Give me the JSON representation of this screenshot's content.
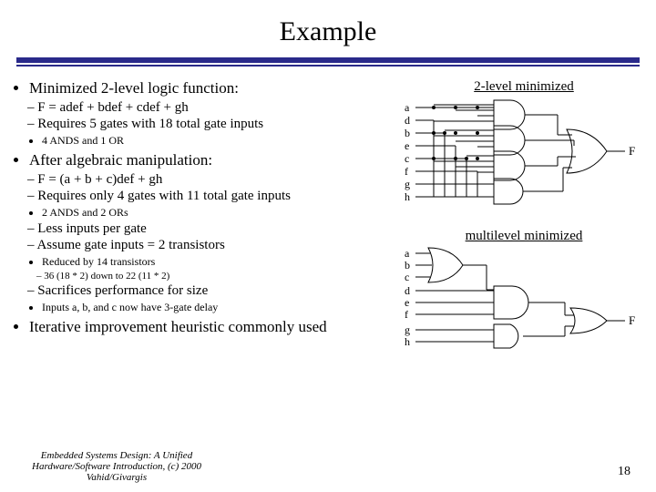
{
  "title": "Example",
  "bullets": {
    "p1": "Minimized 2-level logic function:",
    "p1a": "F = adef + bdef + cdef + gh",
    "p1b": "Requires 5 gates with 18 total gate inputs",
    "p1b1": "4 ANDS and 1 OR",
    "p2": "After algebraic manipulation:",
    "p2a": "F = (a + b + c)def + gh",
    "p2b": "Requires only 4 gates with 11 total gate inputs",
    "p2b1": "2 ANDS and 2 ORs",
    "p2c": "Less inputs per gate",
    "p2d": "Assume gate inputs = 2 transistors",
    "p2d1": "Reduced by 14 transistors",
    "p2d1a": "36 (18 * 2) down to 22 (11 * 2)",
    "p2e": "Sacrifices performance for size",
    "p2e1": "Inputs a, b, and c now have 3-gate delay",
    "p3": "Iterative improvement heuristic commonly used"
  },
  "diagram1": {
    "title": "2-level minimized",
    "inputs": [
      "a",
      "d",
      "b",
      "e",
      "c",
      "f",
      "g",
      "h"
    ],
    "output": "F"
  },
  "diagram2": {
    "title": "multilevel minimized",
    "inputs": [
      "a",
      "b",
      "c",
      "d",
      "e",
      "f",
      "g",
      "h"
    ],
    "output": "F"
  },
  "footer": "Embedded Systems Design: A Unified Hardware/Software Introduction, (c) 2000 Vahid/Givargis",
  "page": "18"
}
